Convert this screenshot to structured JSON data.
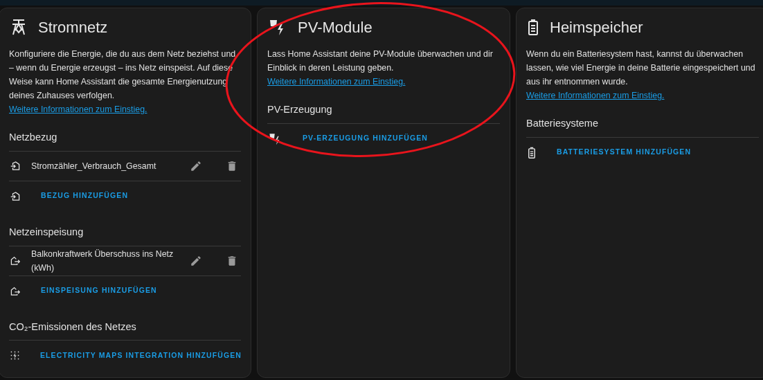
{
  "cards": [
    {
      "kind": "grid",
      "title": "Stromnetz",
      "description": "Konfiguriere die Energie, die du aus dem Netz beziehst und – wenn du Energie erzeugst – ins Netz einspeist. Auf diese Weise kann Home Assistant die gesamte Energienutzung deines Zuhauses verfolgen.",
      "link": "Weitere Informationen zum Einstieg.",
      "sections": [
        {
          "heading": "Netzbezug",
          "kind": "import",
          "entries": [
            {
              "text": "Stromzähler_Verbrauch_Gesamt"
            }
          ],
          "add_label": "BEZUG HINZUFÜGEN"
        },
        {
          "heading": "Netzeinspeisung",
          "kind": "export",
          "entries": [
            {
              "text": "Balkonkraftwerk Überschuss ins Netz (kWh)"
            }
          ],
          "add_label": "EINSPEISUNG HINZUFÜGEN"
        },
        {
          "heading": "CO₂-Emissionen des Netzes",
          "kind": "co2",
          "add_label": "ELECTRICITY MAPS INTEGRATION HINZUFÜGEN"
        }
      ]
    },
    {
      "kind": "solar",
      "title": "PV-Module",
      "description": "Lass Home Assistant deine PV-Module überwachen und dir Einblick in deren Leistung geben.",
      "link": "Weitere Informationen zum Einstieg.",
      "sections": [
        {
          "heading": "PV-Erzeugung",
          "kind": "solar",
          "add_label": "PV-ERZEUGUNG HINZUFÜGEN"
        }
      ]
    },
    {
      "kind": "battery",
      "title": "Heimspeicher",
      "description": "Wenn du ein Batteriesystem hast, kannst du überwachen lassen, wie viel Energie in deine Batterie eingespeichert und aus ihr entnommen wurde.",
      "link": "Weitere Informationen zum Einstieg.",
      "sections": [
        {
          "heading": "Batteriesysteme",
          "kind": "battery",
          "add_label": "BATTERIESYSTEM HINZUFÜGEN"
        }
      ]
    }
  ],
  "annotation": {
    "kind": "ellipse"
  }
}
